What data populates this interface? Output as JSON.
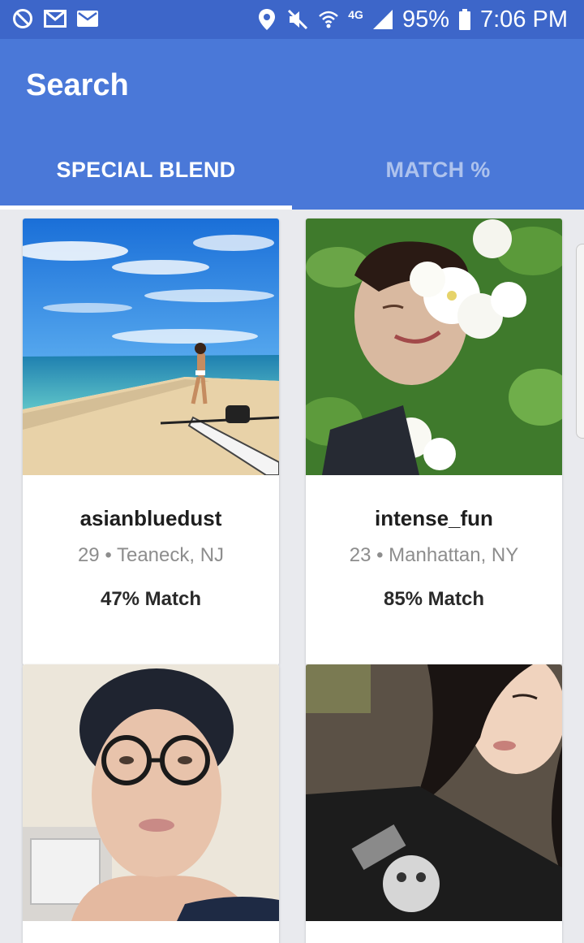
{
  "status_bar": {
    "left_icons": [
      "do-not-disturb-icon",
      "gmail-icon",
      "email-icon"
    ],
    "right_icons": [
      "location-icon",
      "mute-icon",
      "wifi-icon",
      "signal-icon",
      "battery-icon"
    ],
    "network": "4G",
    "battery": "95%",
    "time": "7:06 PM"
  },
  "app_bar": {
    "title": "Search",
    "tabs": [
      {
        "label": "SPECIAL BLEND",
        "active": true
      },
      {
        "label": "MATCH %",
        "active": false
      }
    ]
  },
  "profiles": [
    {
      "username": "asianbluedust",
      "age": "29",
      "location": "Teaneck, NJ",
      "match": "47% Match",
      "photo": "beach-kayak-photo"
    },
    {
      "username": "intense_fun",
      "age": "23",
      "location": "Manhattan, NY",
      "match": "85% Match",
      "photo": "flowers-face-photo"
    },
    {
      "username": "",
      "age": "",
      "location": "",
      "match": "",
      "photo": "glasses-portrait-photo"
    },
    {
      "username": "",
      "age": "",
      "location": "",
      "match": "",
      "photo": "dark-hair-selfie-photo"
    }
  ],
  "separator": "•",
  "colors": {
    "status_bar": "#3d66c9",
    "app_bar": "#4a78d8",
    "background": "#e9eaee"
  }
}
